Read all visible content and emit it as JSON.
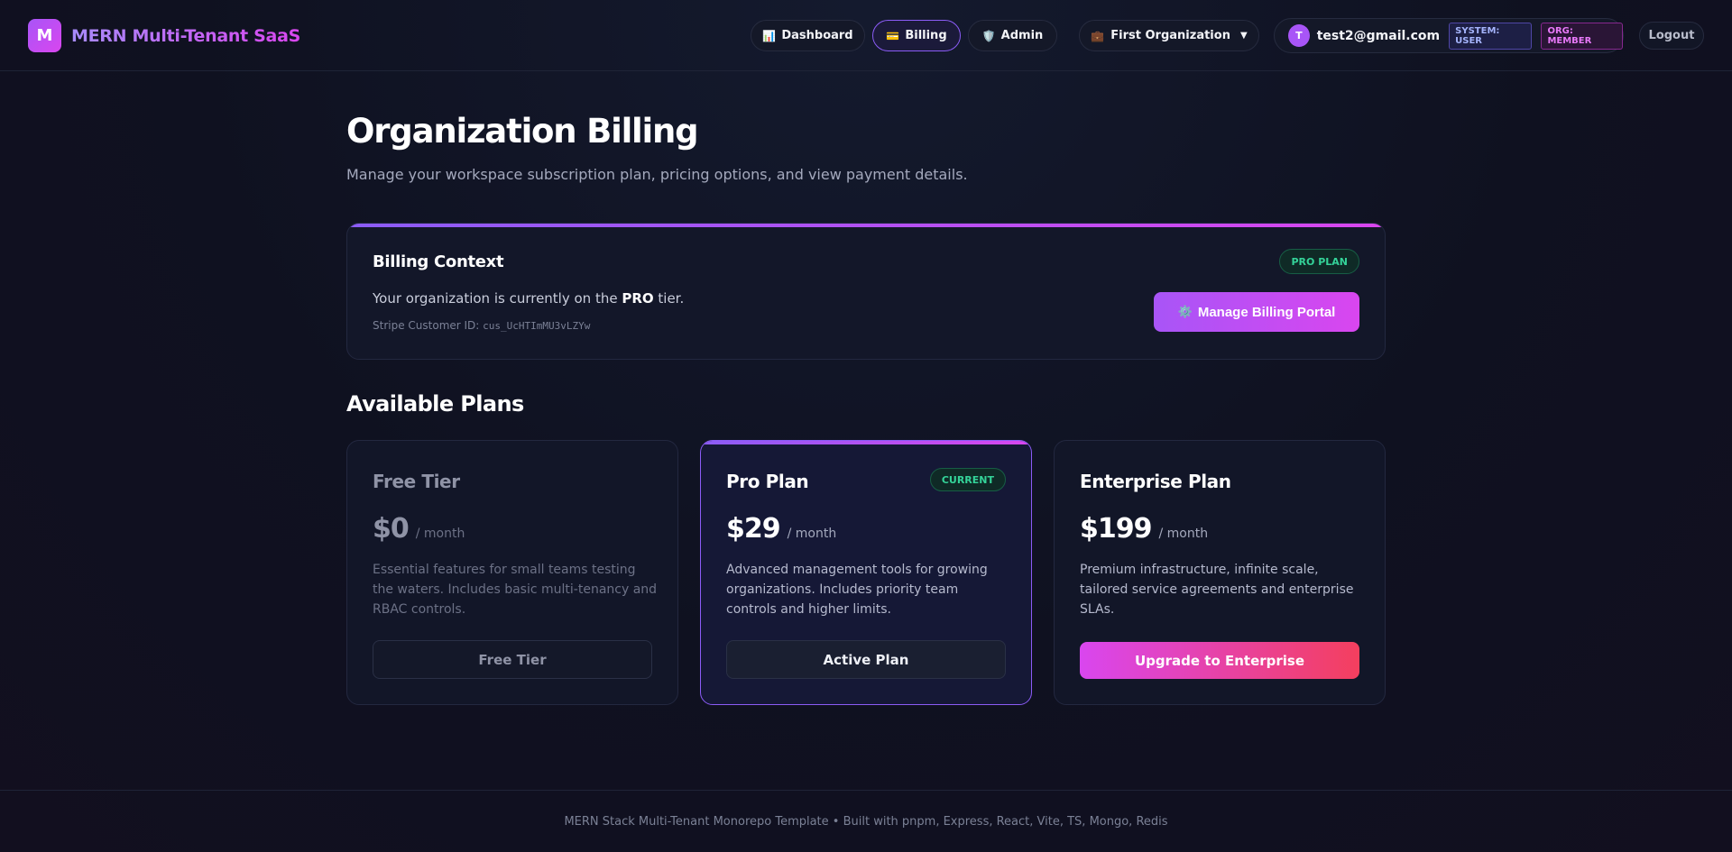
{
  "header": {
    "logo_letter": "M",
    "app_name": "MERN Multi-Tenant SaaS",
    "nav": [
      {
        "label": "Dashboard",
        "icon": "📊"
      },
      {
        "label": "Billing",
        "icon": "💳"
      },
      {
        "label": "Admin",
        "icon": "🛡️"
      }
    ],
    "org": {
      "icon": "💼",
      "label": "First Organization",
      "caret": "▼"
    },
    "user": {
      "initial": "T",
      "email": "test2@gmail.com",
      "system_role": "SYSTEM: USER",
      "org_role": "ORG: MEMBER"
    },
    "logout_label": "Logout"
  },
  "page": {
    "title": "Organization Billing",
    "subtitle": "Manage your workspace subscription plan, pricing options, and view payment details."
  },
  "billing_context": {
    "title": "Billing Context",
    "badge": "PRO PLAN",
    "text_before": "Your organization is currently on the ",
    "tier": "PRO",
    "text_after": " tier.",
    "stripe_label": "Stripe Customer ID: ",
    "stripe_id": "cus_UcHTImMU3vLZYw",
    "portal_icon": "⚙️",
    "portal_label": "Manage Billing Portal"
  },
  "plans_title": "Available Plans",
  "plans": [
    {
      "name": "Free Tier",
      "price": "$0",
      "period": "/ month",
      "description": "Essential features for small teams testing the waters. Includes basic multi-tenancy and RBAC controls.",
      "button": "Free Tier"
    },
    {
      "name": "Pro Plan",
      "badge": "CURRENT",
      "price": "$29",
      "period": "/ month",
      "description": "Advanced management tools for growing organizations. Includes priority team controls and higher limits.",
      "button": "Active Plan"
    },
    {
      "name": "Enterprise Plan",
      "price": "$199",
      "period": "/ month",
      "description": "Premium infrastructure, infinite scale, tailored service agreements and enterprise SLAs.",
      "button": "Upgrade to Enterprise"
    }
  ],
  "footer": "MERN Stack Multi-Tenant Monorepo Template • Built with pnpm, Express, React, Vite, TS, Mongo, Redis",
  "colors": {
    "accent_purple": "#a855f7",
    "accent_pink": "#d946ef",
    "success": "#34d399",
    "upgrade_end": "#f43f5e"
  }
}
